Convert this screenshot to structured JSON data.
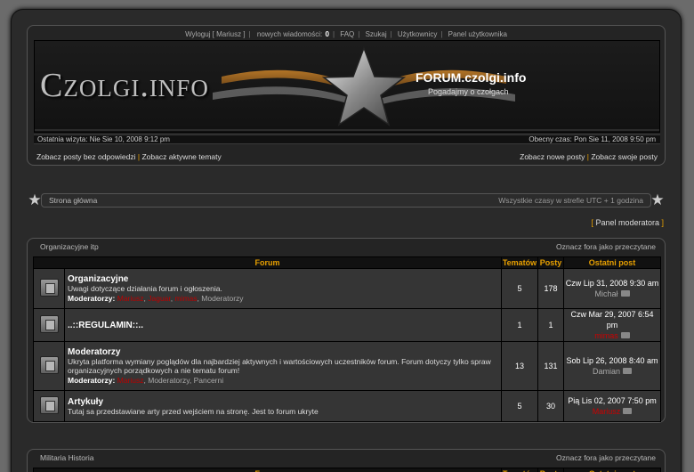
{
  "top_links": [
    "Wyloguj [ Mariusz ]",
    "nowych wiadomości:",
    "0",
    "FAQ",
    "Szukaj",
    "Użytkownicy",
    "Panel użytkownika"
  ],
  "banner": {
    "logo": "Czolgi.info",
    "title": "FORUM.czolgi.info",
    "description": "Pogadajmy o czołgach"
  },
  "info": {
    "last_visit": "Ostatnia wizyta: Nie Sie 10, 2008 9:12 pm",
    "current_time": "Obecny czas: Pon Sie 11, 2008 9:50 pm"
  },
  "search_links": {
    "unanswered": "Zobacz posty bez odpowiedzi",
    "active": "Zobacz aktywne tematy",
    "new": "Zobacz nowe posty",
    "own": "Zobacz swoje posty"
  },
  "breadcrumb": {
    "home": "Strona główna",
    "timezone": "Wszystkie czasy w strefie UTC + 1 godzina"
  },
  "mod_panel": "Panel moderatora",
  "columns": {
    "forum": "Forum",
    "topics": "Tematów",
    "posts": "Posty",
    "last_post": "Ostatni post"
  },
  "categories": [
    {
      "name": "Organizacyjne itp",
      "mark_read": "Oznacz fora jako przeczytane",
      "forums": [
        {
          "name": "Organizacyjne",
          "desc": "Uwagi dotyczące działania forum i ogłoszenia.",
          "mods_label": "Moderatorzy:",
          "mods": [
            "Mariusz",
            "Jaguar",
            "mimas"
          ],
          "mods_tail": "Moderatorzy",
          "topics": "5",
          "posts": "178",
          "last_date": "Czw Lip 31, 2008 9:30 am",
          "last_user": "Michał",
          "last_user_red": false
        },
        {
          "name": "..::REGULAMIN::..",
          "desc": "",
          "mods_label": "",
          "mods": [],
          "mods_tail": "",
          "topics": "1",
          "posts": "1",
          "last_date": "Czw Mar 29, 2007 6:54 pm",
          "last_user": "mimas",
          "last_user_red": true
        },
        {
          "name": "Moderatorzy",
          "desc": "Ukryta platforma wymiany poglądów dla najbardziej aktywnych i wartościowych uczestników forum. Forum dotyczy tylko spraw organizacyjnych porządkowych a nie tematu forum!",
          "mods_label": "Moderatorzy:",
          "mods": [
            "Mariusz"
          ],
          "mods_tail": "Moderatorzy, Pancerni",
          "topics": "13",
          "posts": "131",
          "last_date": "Sob Lip 26, 2008 8:40 am",
          "last_user": "Damian",
          "last_user_red": false
        },
        {
          "name": "Artykuły",
          "desc": "Tutaj sa przedstawiane arty przed wejściem na stronę. Jest to forum ukryte",
          "mods_label": "",
          "mods": [],
          "mods_tail": "",
          "topics": "5",
          "posts": "30",
          "last_date": "Pią Lis 02, 2007 7:50 pm",
          "last_user": "Mariusz",
          "last_user_red": true
        }
      ]
    },
    {
      "name": "Militaria Historia",
      "mark_read": "Oznacz fora jako przeczytane"
    }
  ]
}
